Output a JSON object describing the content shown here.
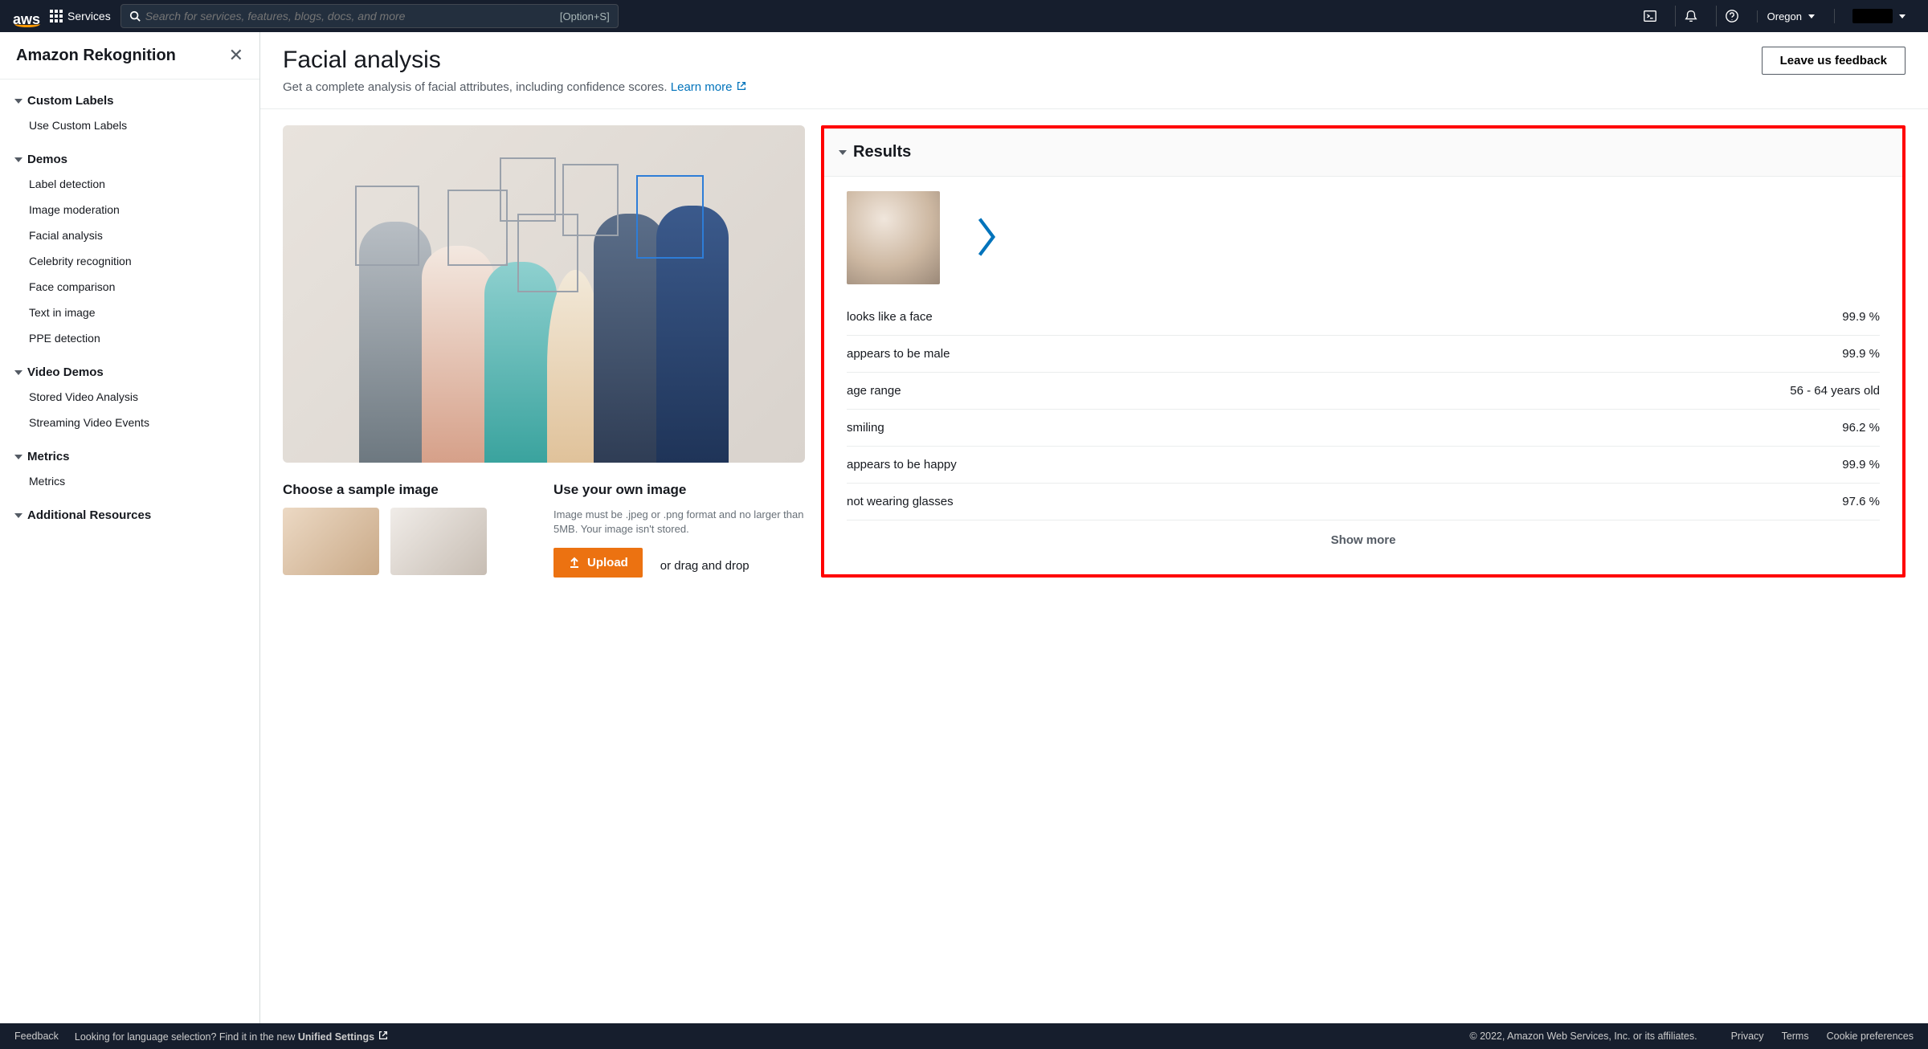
{
  "topnav": {
    "services_label": "Services",
    "search_placeholder": "Search for services, features, blogs, docs, and more",
    "search_shortcut": "[Option+S]",
    "region": "Oregon"
  },
  "sidebar": {
    "service_name": "Amazon Rekognition",
    "sections": [
      {
        "title": "Custom Labels",
        "items": [
          "Use Custom Labels"
        ]
      },
      {
        "title": "Demos",
        "items": [
          "Label detection",
          "Image moderation",
          "Facial analysis",
          "Celebrity recognition",
          "Face comparison",
          "Text in image",
          "PPE detection"
        ]
      },
      {
        "title": "Video Demos",
        "items": [
          "Stored Video Analysis",
          "Streaming Video Events"
        ]
      },
      {
        "title": "Metrics",
        "items": [
          "Metrics"
        ]
      },
      {
        "title": "Additional Resources",
        "items": []
      }
    ]
  },
  "page": {
    "title": "Facial analysis",
    "subtitle": "Get a complete analysis of facial attributes, including confidence scores.",
    "learn_more": "Learn more",
    "feedback_button": "Leave us feedback"
  },
  "chooser": {
    "sample_heading": "Choose a sample image",
    "own_heading": "Use your own image",
    "own_help": "Image must be .jpeg or .png format and no larger than 5MB. Your image isn't stored.",
    "upload_label": "Upload",
    "drag_label": "or drag and drop"
  },
  "results": {
    "heading": "Results",
    "attributes": [
      {
        "label": "looks like a face",
        "value": "99.9 %"
      },
      {
        "label": "appears to be male",
        "value": "99.9 %"
      },
      {
        "label": "age range",
        "value": "56 - 64 years old"
      },
      {
        "label": "smiling",
        "value": "96.2 %"
      },
      {
        "label": "appears to be happy",
        "value": "99.9 %"
      },
      {
        "label": "not wearing glasses",
        "value": "97.6 %"
      }
    ],
    "show_more": "Show more"
  },
  "footer": {
    "feedback": "Feedback",
    "lang_prompt": "Looking for language selection? Find it in the new",
    "unified": "Unified Settings",
    "copyright": "© 2022, Amazon Web Services, Inc. or its affiliates.",
    "links": [
      "Privacy",
      "Terms",
      "Cookie preferences"
    ]
  }
}
